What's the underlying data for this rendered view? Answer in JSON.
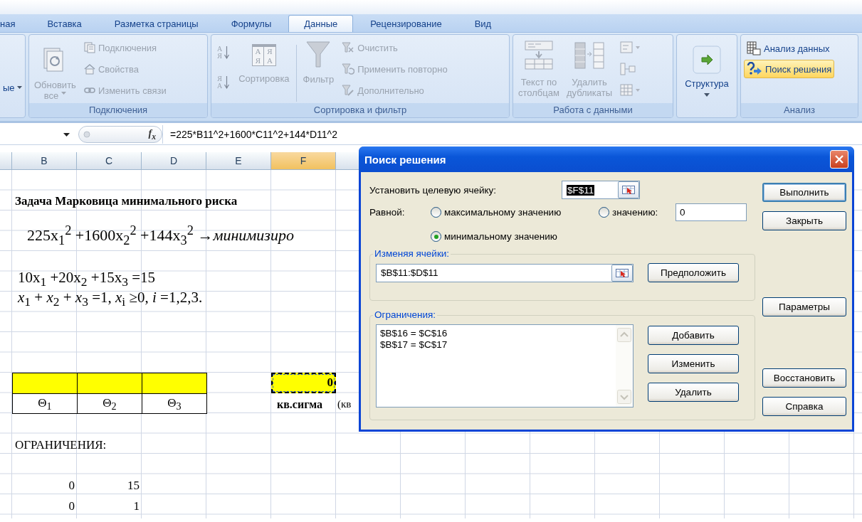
{
  "ribbon": {
    "tabs": [
      {
        "label": "ная",
        "selected": false
      },
      {
        "label": "Вставка",
        "selected": false
      },
      {
        "label": "Разметка страницы",
        "selected": false
      },
      {
        "label": "Формулы",
        "selected": false
      },
      {
        "label": "Данные",
        "selected": true
      },
      {
        "label": "Рецензирование",
        "selected": false
      },
      {
        "label": "Вид",
        "selected": false
      }
    ],
    "external_data": {
      "label": "ые"
    },
    "connections": {
      "title": "Подключения",
      "refresh": {
        "lines": [
          "Обновить",
          "все"
        ],
        "disabled": true
      },
      "items": [
        {
          "label": "Подключения",
          "disabled": true
        },
        {
          "label": "Свойства",
          "disabled": true
        },
        {
          "label": "Изменить связи",
          "disabled": true
        }
      ]
    },
    "sort_filter": {
      "title": "Сортировка и фильтр",
      "sort_asc": {
        "glyphs": [
          "А",
          "Я"
        ],
        "disabled": true
      },
      "sort_desc": {
        "glyphs": [
          "Я",
          "А"
        ],
        "disabled": true
      },
      "sort": {
        "label": "Сортировка",
        "glyphs": [
          "А",
          "Я",
          "Я",
          "А"
        ],
        "disabled": true
      },
      "filter": {
        "label": "Фильтр",
        "disabled": true
      },
      "items": [
        {
          "label": "Очистить",
          "disabled": true
        },
        {
          "label": "Применить повторно",
          "disabled": true
        },
        {
          "label": "Дополнительно",
          "disabled": true
        }
      ]
    },
    "data_tools": {
      "title": "Работа с данными",
      "text_to_columns": {
        "lines": [
          "Текст по",
          "столбцам"
        ],
        "disabled": true
      },
      "remove_duplicates": {
        "lines": [
          "Удалить",
          "дубликаты"
        ],
        "disabled": true
      }
    },
    "outline": {
      "label": "Структура",
      "disabled": false
    },
    "analysis": {
      "title": "Анализ",
      "items": [
        {
          "label": "Анализ данных",
          "selected": false
        },
        {
          "label": "Поиск решения",
          "selected": true
        }
      ]
    }
  },
  "formula_bar": {
    "fx": "f$_{x}$",
    "formula": "=225*B11^2+1600*C11^2+144*D11^2"
  },
  "sheet": {
    "columns": [
      {
        "label": "B",
        "selected": false
      },
      {
        "label": "C",
        "selected": false
      },
      {
        "label": "D",
        "selected": false
      },
      {
        "label": "E",
        "selected": false
      },
      {
        "label": "F",
        "selected": true
      }
    ],
    "title": "Задача Марковица минимального риска",
    "objective": "225x$_{1}$$^{2}$ +1600x$_{2}$$^{2}$ +144x$_{3}$$^{2}$ →*минимизиро*",
    "formulas": [
      "10x$_{1}$ +20x$_{2}$ +15x$_{3}$ =15",
      "*x*$_{1}$ + *x*$_{2}$ + *x*$_{3}$ =1, *x*$_{i}$ ≥0, *i* =1,2,3."
    ],
    "thetas": [
      "Θ$_{1}$",
      "Θ$_{2}$",
      "Θ$_{3}$"
    ],
    "target_cell": "0",
    "target_label": "кв.сигма",
    "next_label": "(кв",
    "constraints_heading": "ОГРАНИЧЕНИЯ:",
    "constraint_values": [
      [
        "0",
        "15"
      ],
      [
        "0",
        "1"
      ]
    ]
  },
  "dialog": {
    "title": "Поиск решения",
    "target": {
      "label": "Установить целевую ячейку:",
      "value": "$F$11"
    },
    "equal_label": "Равной:",
    "options": [
      {
        "label": "максимальному значению",
        "selected": false
      },
      {
        "label": "значению:",
        "selected": false
      },
      {
        "label": "минимальному значению",
        "selected": true
      }
    ],
    "value_field": "0",
    "changing": {
      "legend": "Изменяя ячейки:",
      "value": "$B$11:$D$11",
      "guess_button": "Предположить"
    },
    "constraints": {
      "legend": "Ограничения:",
      "items": [
        "$B$16 = $C$16",
        "$B$17 = $C$17"
      ],
      "buttons": [
        "Добавить",
        "Изменить",
        "Удалить"
      ]
    },
    "side_buttons": [
      {
        "label": "Выполнить",
        "default": true
      },
      {
        "label": "Закрыть",
        "default": false
      },
      {
        "label": "Параметры",
        "default": false
      },
      {
        "label": "Восстановить",
        "default": false
      },
      {
        "label": "Справка",
        "default": false
      }
    ]
  }
}
